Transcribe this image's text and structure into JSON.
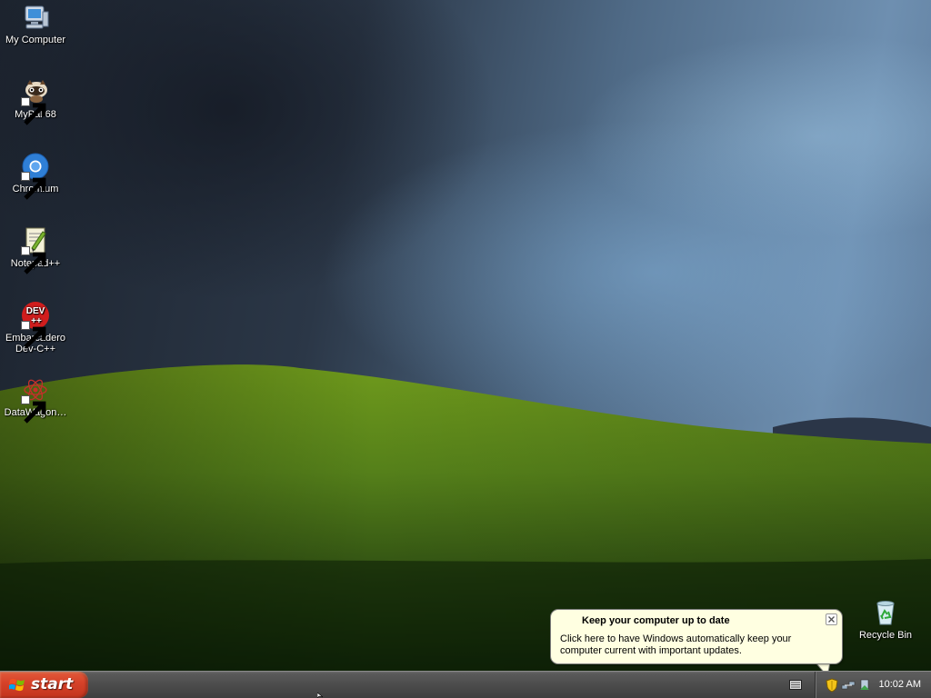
{
  "desktop": {
    "icons": [
      {
        "label": "My Computer",
        "icon": "my-computer-icon",
        "shortcut": false
      },
      {
        "label": "MyPal 68",
        "icon": "mypal-icon",
        "shortcut": true
      },
      {
        "label": "Chromium",
        "icon": "chromium-icon",
        "shortcut": true
      },
      {
        "label": "Notepad++",
        "icon": "notepadpp-icon",
        "shortcut": true
      },
      {
        "label": "Embarcadero\nDev-C++",
        "icon": "devcpp-icon",
        "shortcut": true
      },
      {
        "label": "DataWagon…",
        "icon": "datawagon-icon",
        "shortcut": true
      }
    ],
    "recycle_bin": {
      "label": "Recycle Bin",
      "icon": "recycle-bin-icon"
    },
    "devcpp_badge_top": "DEV",
    "devcpp_badge_bottom": "++"
  },
  "balloon": {
    "title": "Keep your computer up to date",
    "text": "Click here to have Windows automatically keep your computer current with important updates.",
    "icon": "close-icon"
  },
  "taskbar": {
    "start_label": "start",
    "clock": "10:02 AM",
    "tray_icons": [
      "security-shield-icon",
      "network-icon",
      "safely-remove-icon"
    ],
    "keyboard_icon": "keyboard-icon"
  },
  "colors": {
    "start_button": "#d6432a",
    "taskbar": "#4c4c4c",
    "balloon_bg": "#ffffe1"
  }
}
